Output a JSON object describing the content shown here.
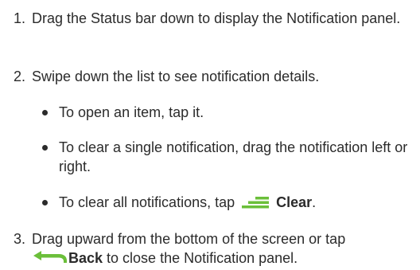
{
  "steps": [
    {
      "number": "1.",
      "text": "Drag the Status bar down to display the Notification panel."
    },
    {
      "number": "2.",
      "text": "Swipe down the list to see notification details."
    },
    {
      "number": "3.",
      "text_pre": "Drag upward from the bottom of the screen or tap",
      "button_label": "Back",
      "text_post": " to close the Notification panel."
    }
  ],
  "bullets": [
    {
      "text": "To open an item, tap it."
    },
    {
      "text": "To clear a single notification, drag the notification left or right."
    },
    {
      "text_pre": "To clear all notifications, tap ",
      "button_label": "Clear",
      "text_post": "."
    }
  ],
  "icons": {
    "clear": "clear-all-icon",
    "back": "back-arrow-icon"
  },
  "colors": {
    "text": "#2b2b2b",
    "accent_green": "#6bbf3a"
  }
}
